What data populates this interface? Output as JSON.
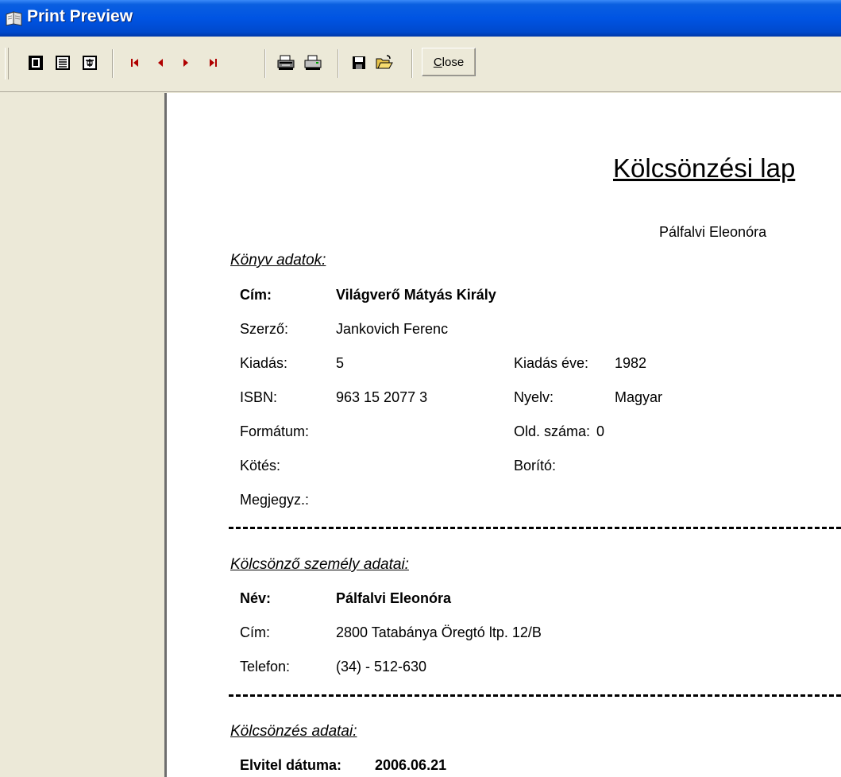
{
  "window": {
    "title": "Print Preview"
  },
  "toolbar": {
    "buttons": [
      {
        "name": "one-page-icon"
      },
      {
        "name": "page-width-icon"
      },
      {
        "name": "fit-page-icon"
      },
      {
        "name": "first-page-icon"
      },
      {
        "name": "prev-page-icon"
      },
      {
        "name": "next-page-icon"
      },
      {
        "name": "last-page-icon"
      },
      {
        "name": "print-setup-icon"
      },
      {
        "name": "print-icon"
      },
      {
        "name": "save-icon"
      },
      {
        "name": "open-folder-icon"
      }
    ],
    "close": {
      "first": "C",
      "rest": "lose"
    }
  },
  "report": {
    "title": "Kölcsönzési lap",
    "subtitle": "Pálfalvi Eleonóra",
    "book": {
      "heading": "Könyv adatok:",
      "title_label": "Cím:",
      "title_value": "Világverő Mátyás Király",
      "author_label": "Szerző:",
      "author_value": "Jankovich Ferenc",
      "edition_label": "Kiadás:",
      "edition_value": "5",
      "year_label": "Kiadás éve:",
      "year_value": "1982",
      "isbn_label": "ISBN:",
      "isbn_value": "963 15 2077 3",
      "lang_label": "Nyelv:",
      "lang_value": "Magyar",
      "format_label": "Formátum:",
      "format_value": "",
      "pages_label": "Old. száma:",
      "pages_value": "0",
      "binding_label": "Kötés:",
      "binding_value": "",
      "cover_label": "Borító:",
      "cover_value": "",
      "note_label": "Megjegyz.:",
      "note_value": ""
    },
    "borrower": {
      "heading": "Kölcsönző személy adatai:",
      "name_label": "Név:",
      "name_value": "Pálfalvi Eleonóra",
      "address_label": "Cím:",
      "address_value": "2800 Tatabánya Öregtó ltp. 12/B",
      "phone_label": "Telefon:",
      "phone_value": "(34) - 512-630"
    },
    "loan": {
      "heading": "Kölcsönzés adatai:",
      "date_label": "Elvitel dátuma:",
      "date_value": "2006.06.21"
    }
  }
}
